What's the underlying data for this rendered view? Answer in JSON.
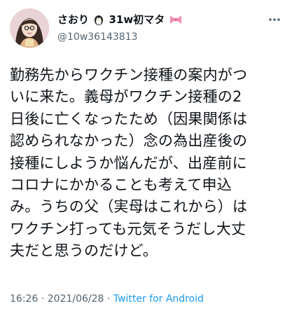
{
  "user": {
    "display_name": "さおり",
    "display_name_suffix": "31w初マタ",
    "emoji_before_suffix": "penguin-emoji",
    "emoji_after_suffix": "ribbon-emoji",
    "handle": "@10w36143813"
  },
  "more_icon": "more-icon",
  "tweet": {
    "text": "勤務先からワクチン接種の案内がつ\nいに来た。義母がワクチン接種の2\n日後に亡くなったため（因果関係は\n認められなかった）念の為出産後の\n接種にしようか悩んだが、出産前に\nコロナにかかることも考えて申込\nみ。うちの父（実母はこれから）は\nワクチン打っても元気そうだし大丈\n夫だと思うのだけど。"
  },
  "meta": {
    "time": "16:26",
    "separator1": " · ",
    "date": "2021/06/28",
    "separator2": " · ",
    "source": "Twitter for Android"
  },
  "colors": {
    "text": "#0f1419",
    "secondary": "#536471",
    "link": "#1d9bf0",
    "ribbon": "#f28fb3"
  }
}
